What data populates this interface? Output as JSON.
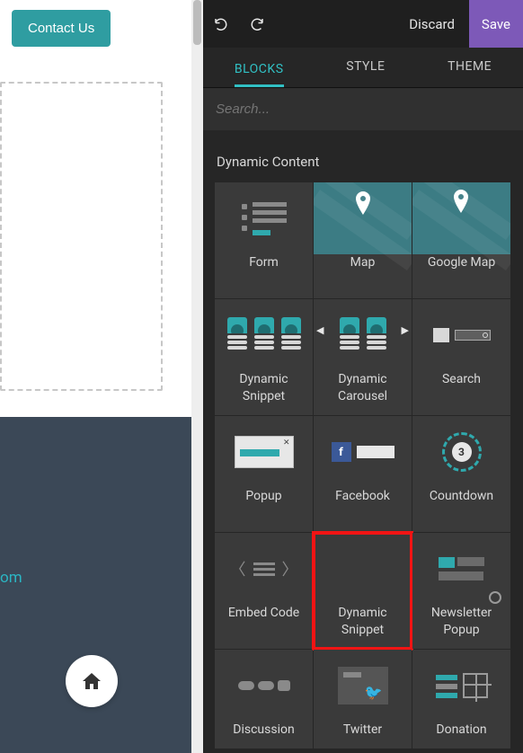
{
  "left": {
    "contact_label": "Contact Us",
    "footer_link": "om"
  },
  "topbar": {
    "discard": "Discard",
    "save": "Save"
  },
  "tabs": {
    "blocks": "BLOCKS",
    "style": "STYLE",
    "theme": "THEME",
    "active": "blocks"
  },
  "search": {
    "placeholder": "Search..."
  },
  "section": {
    "title": "Dynamic Content"
  },
  "blocks": [
    {
      "id": "form",
      "label": "Form"
    },
    {
      "id": "map",
      "label": "Map"
    },
    {
      "id": "google-map",
      "label": "Google Map"
    },
    {
      "id": "dynamic-snippet",
      "label": "Dynamic Snippet"
    },
    {
      "id": "dynamic-carousel",
      "label": "Dynamic Carousel"
    },
    {
      "id": "search",
      "label": "Search"
    },
    {
      "id": "popup",
      "label": "Popup"
    },
    {
      "id": "facebook",
      "label": "Facebook"
    },
    {
      "id": "countdown",
      "label": "Countdown",
      "badge": "3"
    },
    {
      "id": "embed-code",
      "label": "Embed Code"
    },
    {
      "id": "dynamic-snippet2",
      "label": "Dynamic Snippet",
      "highlight": true
    },
    {
      "id": "newsletter-popup",
      "label": "Newsletter Popup"
    },
    {
      "id": "discussion",
      "label": "Discussion"
    },
    {
      "id": "twitter",
      "label": "Twitter"
    },
    {
      "id": "donation",
      "label": "Donation"
    }
  ],
  "colors": {
    "accent": "#31c0c4",
    "save": "#7d59b8",
    "highlight": "#f21414"
  }
}
